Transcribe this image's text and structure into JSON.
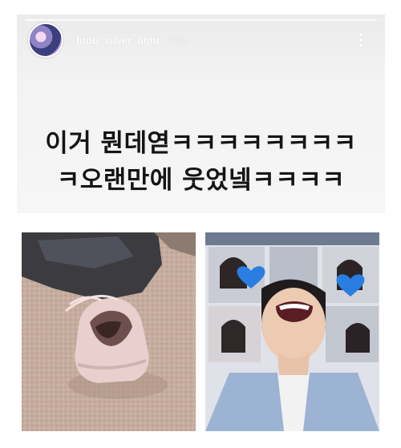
{
  "story": {
    "username": "btob_silver_light",
    "time": "13m",
    "caption_line1": "이거 뭔데엳ㅋㅋㅋㅋㅋㅋㅋㅋ",
    "caption_line2": "ㅋ오랜만에 웃었넼ㅋㅋㅋㅋ"
  },
  "icons": {
    "more": "more-vertical-icon",
    "heart": "blue-heart-icon"
  },
  "colors": {
    "story_bg": "#f0f0f0",
    "caption": "#151515",
    "heart": "#2a7de1"
  }
}
